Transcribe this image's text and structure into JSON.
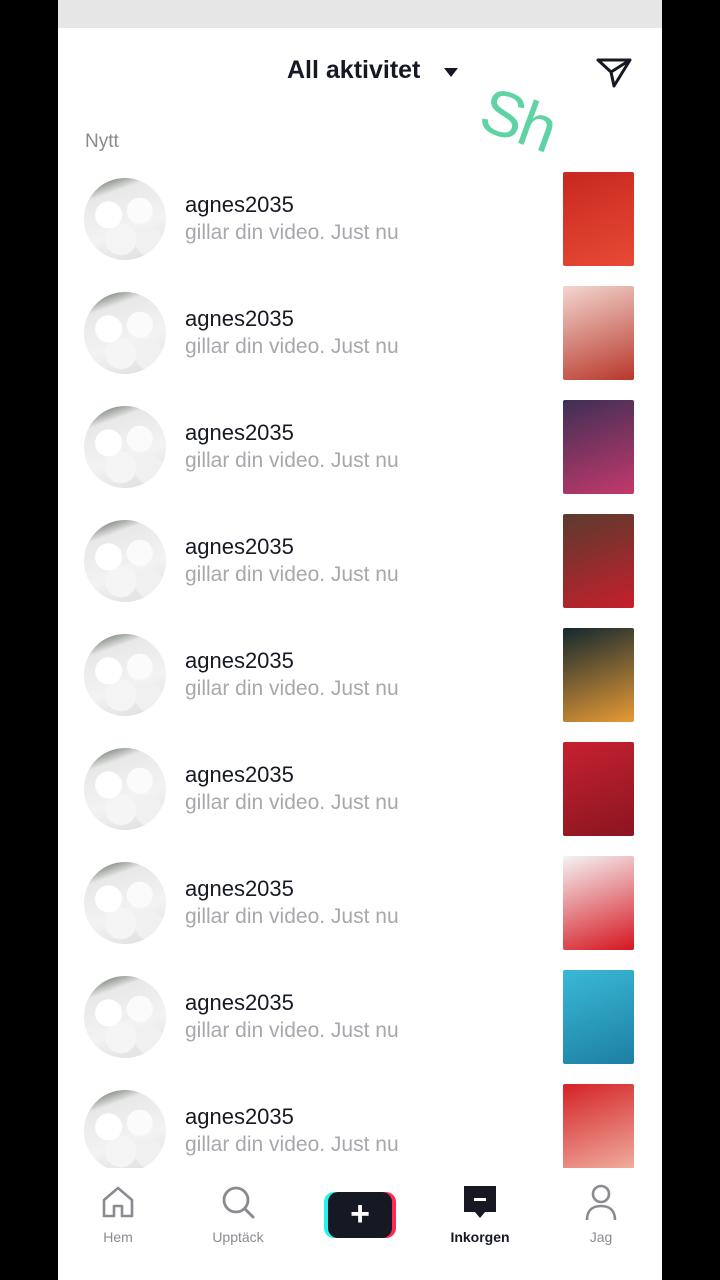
{
  "header": {
    "title": "All aktivitet"
  },
  "watermark": "Sh",
  "section": {
    "label": "Nytt"
  },
  "notifications": [
    {
      "username": "agnes2035",
      "text": "gillar din video. Just nu",
      "thumb_colors": [
        "#c7281f",
        "#e84a36"
      ]
    },
    {
      "username": "agnes2035",
      "text": "gillar din video. Just nu",
      "thumb_colors": [
        "#f3d6cf",
        "#b8372a"
      ]
    },
    {
      "username": "agnes2035",
      "text": "gillar din video. Just nu",
      "thumb_colors": [
        "#3e2f55",
        "#c3396b"
      ]
    },
    {
      "username": "agnes2035",
      "text": "gillar din video. Just nu",
      "thumb_colors": [
        "#5a3b2e",
        "#c61f2c"
      ]
    },
    {
      "username": "agnes2035",
      "text": "gillar din video. Just nu",
      "thumb_colors": [
        "#13282f",
        "#e89a35"
      ]
    },
    {
      "username": "agnes2035",
      "text": "gillar din video. Just nu",
      "thumb_colors": [
        "#c62130",
        "#8a1520"
      ]
    },
    {
      "username": "agnes2035",
      "text": "gillar din video. Just nu",
      "thumb_colors": [
        "#f4f4f4",
        "#d5151f"
      ]
    },
    {
      "username": "agnes2035",
      "text": "gillar din video. Just nu",
      "thumb_colors": [
        "#39b9d6",
        "#1d7fa3"
      ]
    },
    {
      "username": "agnes2035",
      "text": "gillar din video. Just nu",
      "thumb_colors": [
        "#d42226",
        "#f2b8a8"
      ]
    }
  ],
  "tabs": [
    {
      "label": "Hem",
      "icon": "home-icon"
    },
    {
      "label": "Upptäck",
      "icon": "search-icon"
    },
    {
      "label": "",
      "icon": "plus-icon"
    },
    {
      "label": "Inkorgen",
      "icon": "inbox-icon"
    },
    {
      "label": "Jag",
      "icon": "profile-icon"
    }
  ]
}
